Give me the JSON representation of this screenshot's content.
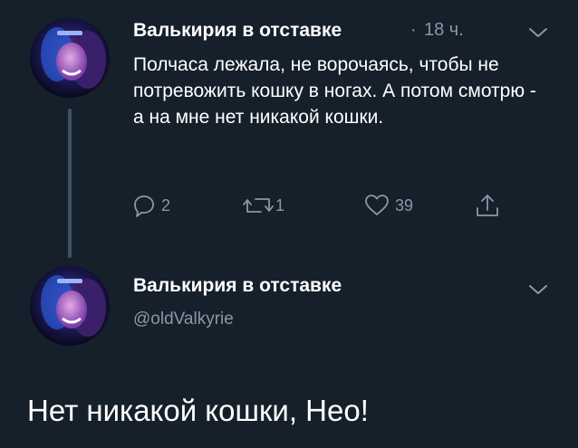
{
  "tweet1": {
    "author_name": "Валькирия в отставке",
    "separator": "·",
    "time": "18 ч.",
    "text": "Полчаса лежала, не ворочаясь, чтобы не потревожить кошку в ногах. А потом смотрю - а на мне нет никакой кошки.",
    "actions": {
      "reply_count": "2",
      "retweet_count": "1",
      "like_count": "39"
    },
    "icons": [
      "reply-icon",
      "retweet-icon",
      "like-icon",
      "share-icon",
      "chevron-down-icon"
    ]
  },
  "tweet2": {
    "author_name": "Валькирия в отставке",
    "handle": "@oldValkyrie",
    "text": "Нет никакой кошки, Нео!"
  },
  "colors": {
    "background": "#15202b",
    "primary_text": "#ffffff",
    "secondary_text": "#8899a6",
    "thread_line": "#3d5466"
  }
}
